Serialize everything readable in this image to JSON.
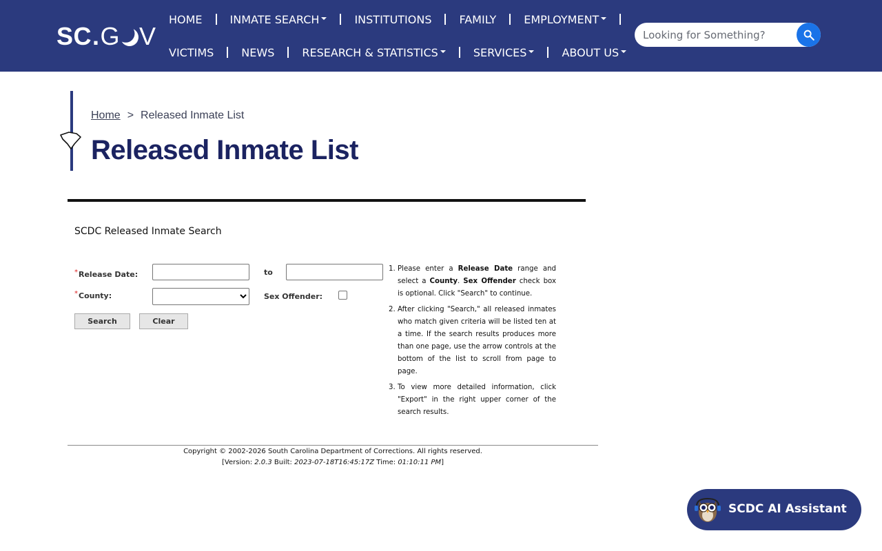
{
  "header": {
    "logo": {
      "sc": "SC",
      "dot": ".",
      "g": "G",
      "v": "V"
    },
    "nav_row1": [
      {
        "label": "HOME",
        "dropdown": false
      },
      {
        "label": "INMATE SEARCH",
        "dropdown": true
      },
      {
        "label": "INSTITUTIONS",
        "dropdown": false
      },
      {
        "label": "FAMILY",
        "dropdown": false
      },
      {
        "label": "EMPLOYMENT",
        "dropdown": true
      }
    ],
    "nav_row2": [
      {
        "label": "VICTIMS",
        "dropdown": false
      },
      {
        "label": "NEWS",
        "dropdown": false
      },
      {
        "label": "RESEARCH & STATISTICS",
        "dropdown": true
      },
      {
        "label": "SERVICES",
        "dropdown": true
      },
      {
        "label": "ABOUT US",
        "dropdown": true
      }
    ],
    "search": {
      "placeholder": "Looking for Something?",
      "value": "",
      "icon": "search-icon"
    },
    "colors": {
      "background": "#2b3a7e",
      "search_button": "#1a73e8"
    }
  },
  "breadcrumb": {
    "home": "Home",
    "separator": ">",
    "current": "Released Inmate List"
  },
  "page_title": "Released Inmate List",
  "form": {
    "heading": "SCDC Released Inmate Search",
    "required_marker": "*",
    "release_date_label": "Release Date:",
    "to_label": "to",
    "county_label": "County:",
    "sex_offender_label": "Sex Offender:",
    "release_date_from": "",
    "release_date_to": "",
    "county_selected": "",
    "sex_offender_checked": false,
    "search_button": "Search",
    "clear_button": "Clear"
  },
  "instructions": {
    "item1": {
      "num": "1.",
      "t1": "Please enter a ",
      "b1": "Release Date",
      "t2": " range and select a ",
      "b2": "County",
      "t3": ". ",
      "b3": "Sex Offender",
      "t4": " check box is optional. Click \"Search\" to continue."
    },
    "item2": {
      "num": "2.",
      "text": "After clicking \"Search,\" all released inmates who match given criteria will be listed ten at a time. If the search results produces more than one page, use the arrow controls at the bottom of the list to scroll from page to page."
    },
    "item3": {
      "num": "3.",
      "text": "To view more detailed information, click \"Export\" in the right upper corner of the search results."
    }
  },
  "footer": {
    "copyright": "Copyright © 2002-2026 South Carolina Department of Corrections. All rights reserved.",
    "version_prefix": "[Version: ",
    "version": "2.0.3",
    "built_label": " Built: ",
    "built": "2023-07-18T16:45:17Z",
    "time_label": " Time: ",
    "time": "01:10:11 PM",
    "suffix": "]"
  },
  "assistant": {
    "label": "SCDC AI Assistant",
    "icon": "owl-avatar-icon"
  }
}
